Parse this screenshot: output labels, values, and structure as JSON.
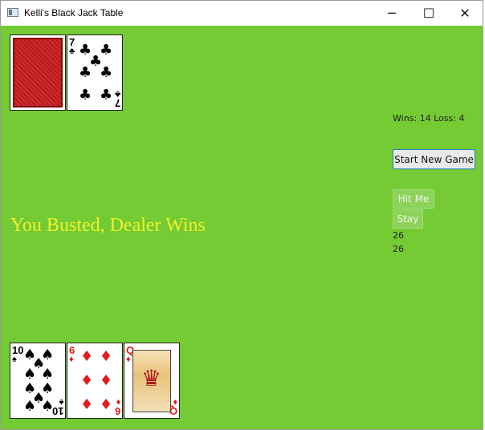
{
  "window": {
    "title": "Kelli's Black Jack Table",
    "controls": {
      "minimize": "─",
      "maximize": "☐",
      "close": "✕"
    }
  },
  "colors": {
    "table": "#74cb33",
    "status_text": "#f1f12c"
  },
  "dealer_hand": {
    "cards": [
      {
        "face_down": true
      },
      {
        "rank": "7",
        "suit": "♣",
        "suit_name": "clubs",
        "color": "black"
      }
    ]
  },
  "player_hand": {
    "cards": [
      {
        "rank": "10",
        "suit": "♠",
        "suit_name": "spades",
        "color": "black"
      },
      {
        "rank": "6",
        "suit": "♦",
        "suit_name": "diamonds",
        "color": "red"
      },
      {
        "rank": "Q",
        "suit": "♦",
        "suit_name": "diamonds",
        "color": "red"
      }
    ]
  },
  "stats": {
    "text": "Wins: 14   Loss: 4"
  },
  "buttons": {
    "start_new_game": "Start New Game",
    "hit_me": "Hit Me",
    "stay": "Stay"
  },
  "scores": {
    "line1": "26",
    "line2": "26"
  },
  "status_message": "You Busted, Dealer Wins"
}
